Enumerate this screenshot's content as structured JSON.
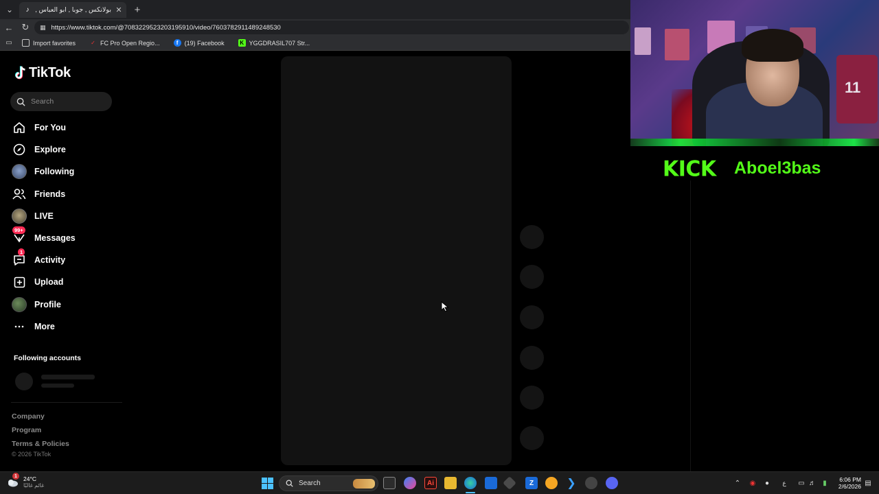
{
  "browser": {
    "tab": {
      "title": "بولانكس , جوبا , ابو العباس , عزيز ..."
    },
    "url": "https://www.tiktok.com/@7083229523203195910/video/7603782911489248530",
    "bookmarks": [
      {
        "label": "Import favorites"
      },
      {
        "label": "FC Pro Open Regio..."
      },
      {
        "label": "(19) Facebook"
      },
      {
        "label": "YGGDRASIL707 Str..."
      }
    ]
  },
  "sidebar": {
    "logo": "TikTok",
    "search_placeholder": "Search",
    "nav": [
      {
        "label": "For You",
        "icon": "home-icon"
      },
      {
        "label": "Explore",
        "icon": "compass-icon"
      },
      {
        "label": "Following",
        "icon": "following-avatar"
      },
      {
        "label": "Friends",
        "icon": "friends-icon"
      },
      {
        "label": "LIVE",
        "icon": "live-avatar"
      },
      {
        "label": "Messages",
        "icon": "messages-icon",
        "badge": "99+"
      },
      {
        "label": "Activity",
        "icon": "activity-icon",
        "badge": "1"
      },
      {
        "label": "Upload",
        "icon": "upload-icon"
      },
      {
        "label": "Profile",
        "icon": "profile-avatar"
      },
      {
        "label": "More",
        "icon": "more-icon"
      }
    ],
    "following_accounts_title": "Following accounts",
    "footer": {
      "links": [
        "Company",
        "Program",
        "Terms & Policies"
      ],
      "copyright": "© 2026 TikTok"
    }
  },
  "stream_overlay": {
    "platform": "KICK",
    "channel": "Aboel3bas",
    "jersey_number": "11"
  },
  "taskbar": {
    "weather": {
      "temp": "24°C",
      "desc": "غائم غالبًا",
      "alert_badge": "1"
    },
    "search_label": "Search",
    "clock": {
      "time": "6:06 PM",
      "date": "2/6/2026"
    },
    "input_lang": "ع",
    "colors": {
      "accent": "#4cc2ff",
      "tiktok_red": "#fe2c55",
      "kick_green": "#53fc18"
    }
  }
}
